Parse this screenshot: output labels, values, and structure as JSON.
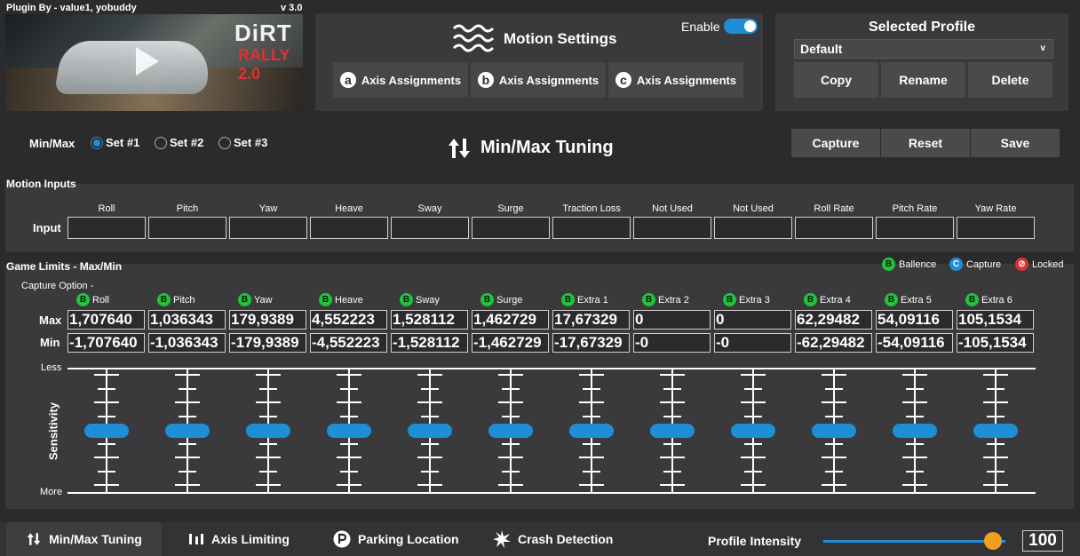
{
  "header": {
    "plugin_by": "Plugin By - value1, yobuddy",
    "version": "v 3.0"
  },
  "banner": {
    "logo_line1": "DiRT",
    "logo_line2": "RALLY 2.0"
  },
  "motion_settings": {
    "title": "Motion Settings",
    "enable_label": "Enable",
    "enabled": true,
    "axis_buttons": [
      {
        "letter": "a",
        "label": "Axis Assignments"
      },
      {
        "letter": "b",
        "label": "Axis Assignments"
      },
      {
        "letter": "c",
        "label": "Axis Assignments"
      }
    ]
  },
  "profile": {
    "title": "Selected Profile",
    "selected": "Default",
    "chevron": "v",
    "buttons": [
      "Copy",
      "Rename",
      "Delete"
    ]
  },
  "minmax": {
    "label": "Min/Max",
    "sets": [
      "Set #1",
      "Set #2",
      "Set #3"
    ],
    "selected_index": 0,
    "title": "Min/Max Tuning",
    "actions": [
      "Capture",
      "Reset",
      "Save"
    ]
  },
  "motion_inputs": {
    "title": "Motion Inputs",
    "row_label": "Input",
    "columns": [
      "Roll",
      "Pitch",
      "Yaw",
      "Heave",
      "Sway",
      "Surge",
      "Traction Loss",
      "Not Used",
      "Not Used",
      "Roll Rate",
      "Pitch Rate",
      "Yaw Rate"
    ]
  },
  "game_limits": {
    "title": "Game Limits - Max/Min",
    "legend": [
      {
        "badge": "B",
        "label": "Ballence",
        "color": "#22c33a"
      },
      {
        "badge": "C",
        "label": "Capture",
        "color": "#1e8fd6"
      },
      {
        "badge": "⊘",
        "label": "Locked",
        "color": "#e03030"
      }
    ],
    "capture_option_label": "Capture Option -",
    "max_label": "Max",
    "min_label": "Min",
    "columns": [
      {
        "badge": "B",
        "name": "Roll",
        "max": "1,707640",
        "min": "-1,707640"
      },
      {
        "badge": "B",
        "name": "Pitch",
        "max": "1,036343",
        "min": "-1,036343"
      },
      {
        "badge": "B",
        "name": "Yaw",
        "max": "179,9389",
        "min": "-179,9389"
      },
      {
        "badge": "B",
        "name": "Heave",
        "max": "4,552223",
        "min": "-4,552223"
      },
      {
        "badge": "B",
        "name": "Sway",
        "max": "1,528112",
        "min": "-1,528112"
      },
      {
        "badge": "B",
        "name": "Surge",
        "max": "1,462729",
        "min": "-1,462729"
      },
      {
        "badge": "B",
        "name": "Extra 1",
        "max": "17,67329",
        "min": "-17,67329"
      },
      {
        "badge": "B",
        "name": "Extra 2",
        "max": "0",
        "min": "-0"
      },
      {
        "badge": "B",
        "name": "Extra 3",
        "max": "0",
        "min": "-0"
      },
      {
        "badge": "B",
        "name": "Extra 4",
        "max": "62,29482",
        "min": "-62,29482"
      },
      {
        "badge": "B",
        "name": "Extra 5",
        "max": "54,09116",
        "min": "-54,09116"
      },
      {
        "badge": "B",
        "name": "Extra 6",
        "max": "105,1534",
        "min": "-105,1534"
      }
    ],
    "sensitivity_label": "Sensitivity",
    "less_label": "Less",
    "more_label": "More",
    "sensitivity_levels": [
      0.5,
      0.5,
      0.5,
      0.5,
      0.5,
      0.5,
      0.5,
      0.5,
      0.5,
      0.5,
      0.5,
      0.5
    ]
  },
  "bottom_tabs": [
    {
      "label": "Min/Max Tuning",
      "icon": "arrows-updown-icon",
      "active": true
    },
    {
      "label": "Axis Limiting",
      "icon": "bars-icon",
      "active": false
    },
    {
      "label": "Parking Location",
      "icon": "parking-icon",
      "active": false
    },
    {
      "label": "Crash Detection",
      "icon": "crash-icon",
      "active": false
    }
  ],
  "intensity": {
    "label": "Profile Intensity",
    "value": "100",
    "level": 0.93
  }
}
